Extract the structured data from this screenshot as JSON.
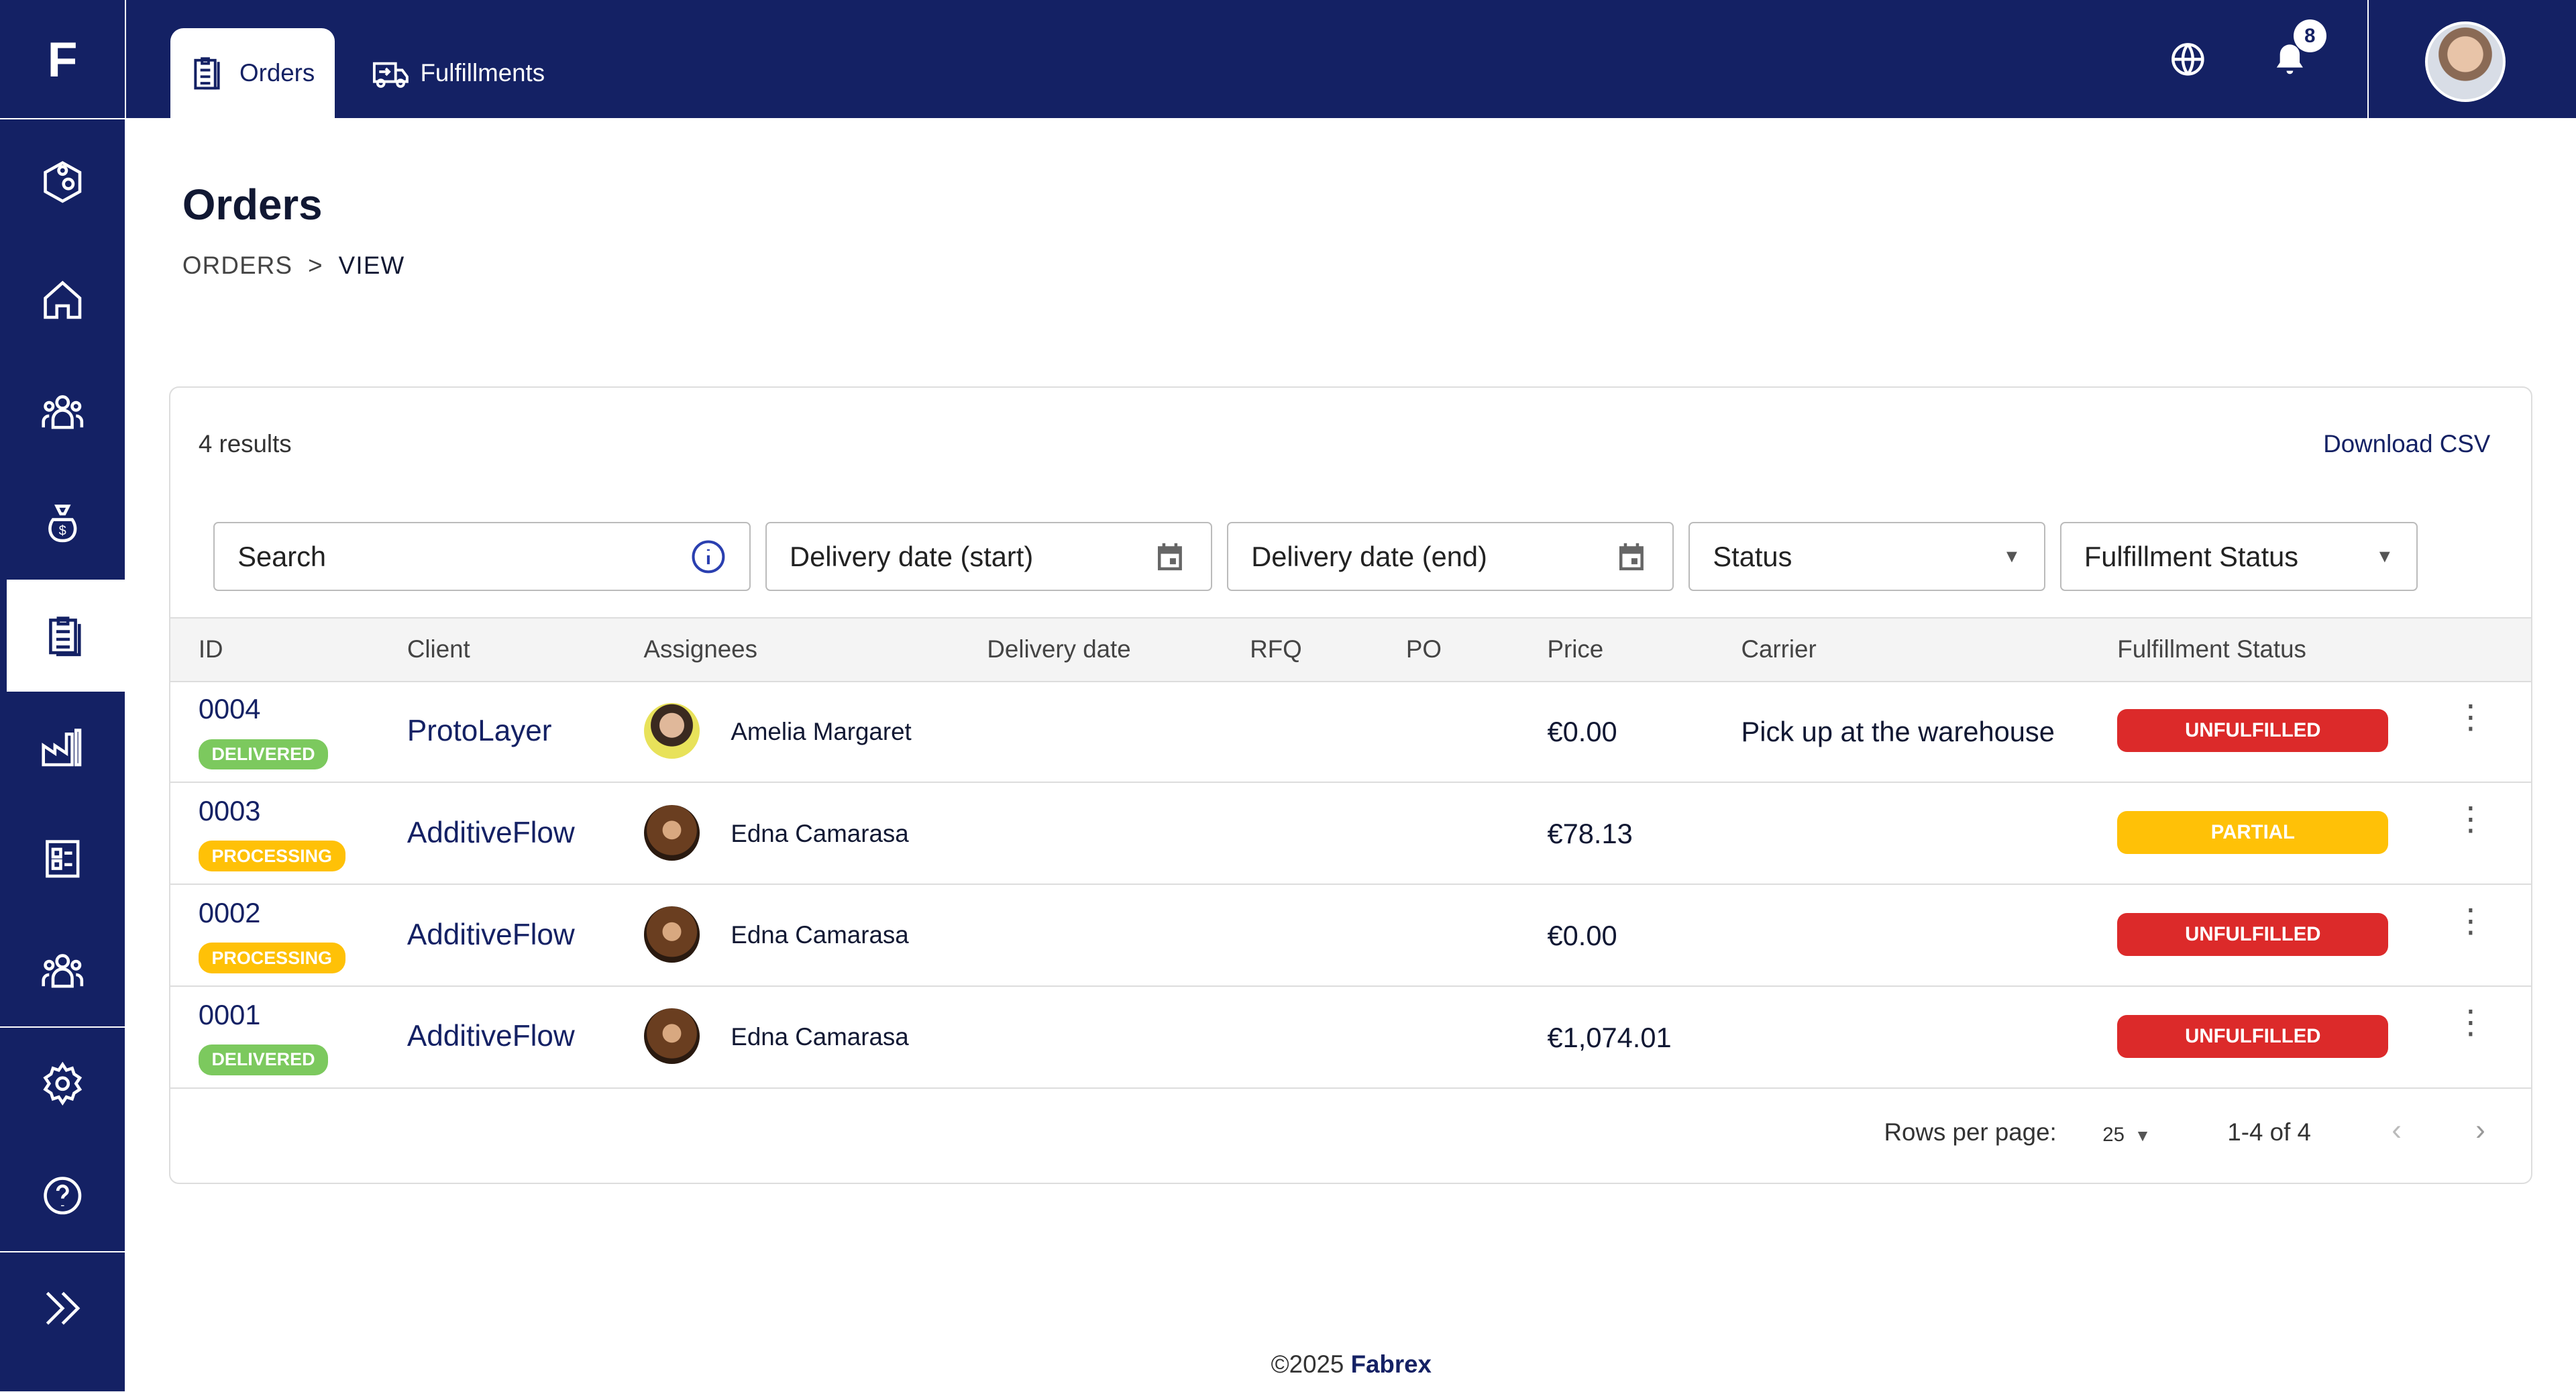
{
  "app": {
    "logo": "F",
    "brand": "Fabrex",
    "copyright": "©2025"
  },
  "tabs": [
    {
      "label": "Orders"
    },
    {
      "label": "Fulfillments"
    }
  ],
  "notifications": {
    "count": "8"
  },
  "page": {
    "title": "Orders",
    "breadcrumb": [
      "ORDERS",
      ">",
      "VIEW"
    ]
  },
  "card": {
    "results": "4 results",
    "download": "Download CSV"
  },
  "filters": {
    "search": "Search",
    "date_start": "Delivery date (start)",
    "date_end": "Delivery date (end)",
    "status": "Status",
    "fulfillment": "Fulfillment Status"
  },
  "columns": [
    "ID",
    "Client",
    "Assignees",
    "Delivery date",
    "RFQ",
    "PO",
    "Price",
    "Carrier",
    "Fulfillment Status"
  ],
  "rows": [
    {
      "id": "0004",
      "status": "DELIVERED",
      "client": "ProtoLayer",
      "assignee": "Amelia Margaret",
      "price": "€0.00",
      "carrier": "Pick up at the warehouse",
      "fulfillment": "UNFULFILLED"
    },
    {
      "id": "0003",
      "status": "PROCESSING",
      "client": "AdditiveFlow",
      "assignee": "Edna Camarasa",
      "price": "€78.13",
      "carrier": "",
      "fulfillment": "PARTIAL"
    },
    {
      "id": "0002",
      "status": "PROCESSING",
      "client": "AdditiveFlow",
      "assignee": "Edna Camarasa",
      "price": "€0.00",
      "carrier": "",
      "fulfillment": "UNFULFILLED"
    },
    {
      "id": "0001",
      "status": "DELIVERED",
      "client": "AdditiveFlow",
      "assignee": "Edna Camarasa",
      "price": "€1,074.01",
      "carrier": "",
      "fulfillment": "UNFULFILLED"
    }
  ],
  "pagination": {
    "rows_label": "Rows per page:",
    "rows_value": "25",
    "range": "1-4 of 4"
  },
  "colors": {
    "navy": "#142164",
    "delivered": "#7cc95e",
    "processing": "#ffc107",
    "unfulfilled": "#dc2a2a",
    "partial": "#ffc107"
  }
}
